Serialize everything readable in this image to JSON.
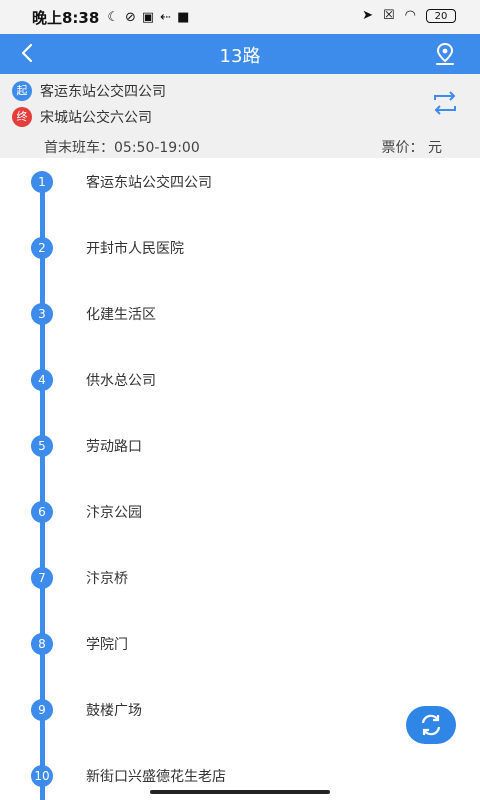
{
  "status": {
    "time": "晚上8:38",
    "battery": "20"
  },
  "header": {
    "title": "13路"
  },
  "route": {
    "start_badge": "起",
    "start_stop": "客运东站公交四公司",
    "end_badge": "终",
    "end_stop": "宋城站公交六公司",
    "schedule": "首末班车：05:50-19:00",
    "price": "票价：  元"
  },
  "stops": [
    {
      "num": "1",
      "name": "客运东站公交四公司"
    },
    {
      "num": "2",
      "name": "开封市人民医院"
    },
    {
      "num": "3",
      "name": "化建生活区"
    },
    {
      "num": "4",
      "name": "供水总公司"
    },
    {
      "num": "5",
      "name": "劳动路口"
    },
    {
      "num": "6",
      "name": "汴京公园"
    },
    {
      "num": "7",
      "name": "汴京桥"
    },
    {
      "num": "8",
      "name": "学院门"
    },
    {
      "num": "9",
      "name": "鼓楼广场"
    },
    {
      "num": "10",
      "name": "新街口兴盛德花生老店"
    }
  ],
  "colors": {
    "accent": "#3d8bea",
    "end_badge": "#e53c3c"
  },
  "icons": {
    "back": "back-arrow-icon",
    "location": "location-pin-icon",
    "swap": "swap-direction-icon",
    "refresh": "refresh-icon"
  }
}
